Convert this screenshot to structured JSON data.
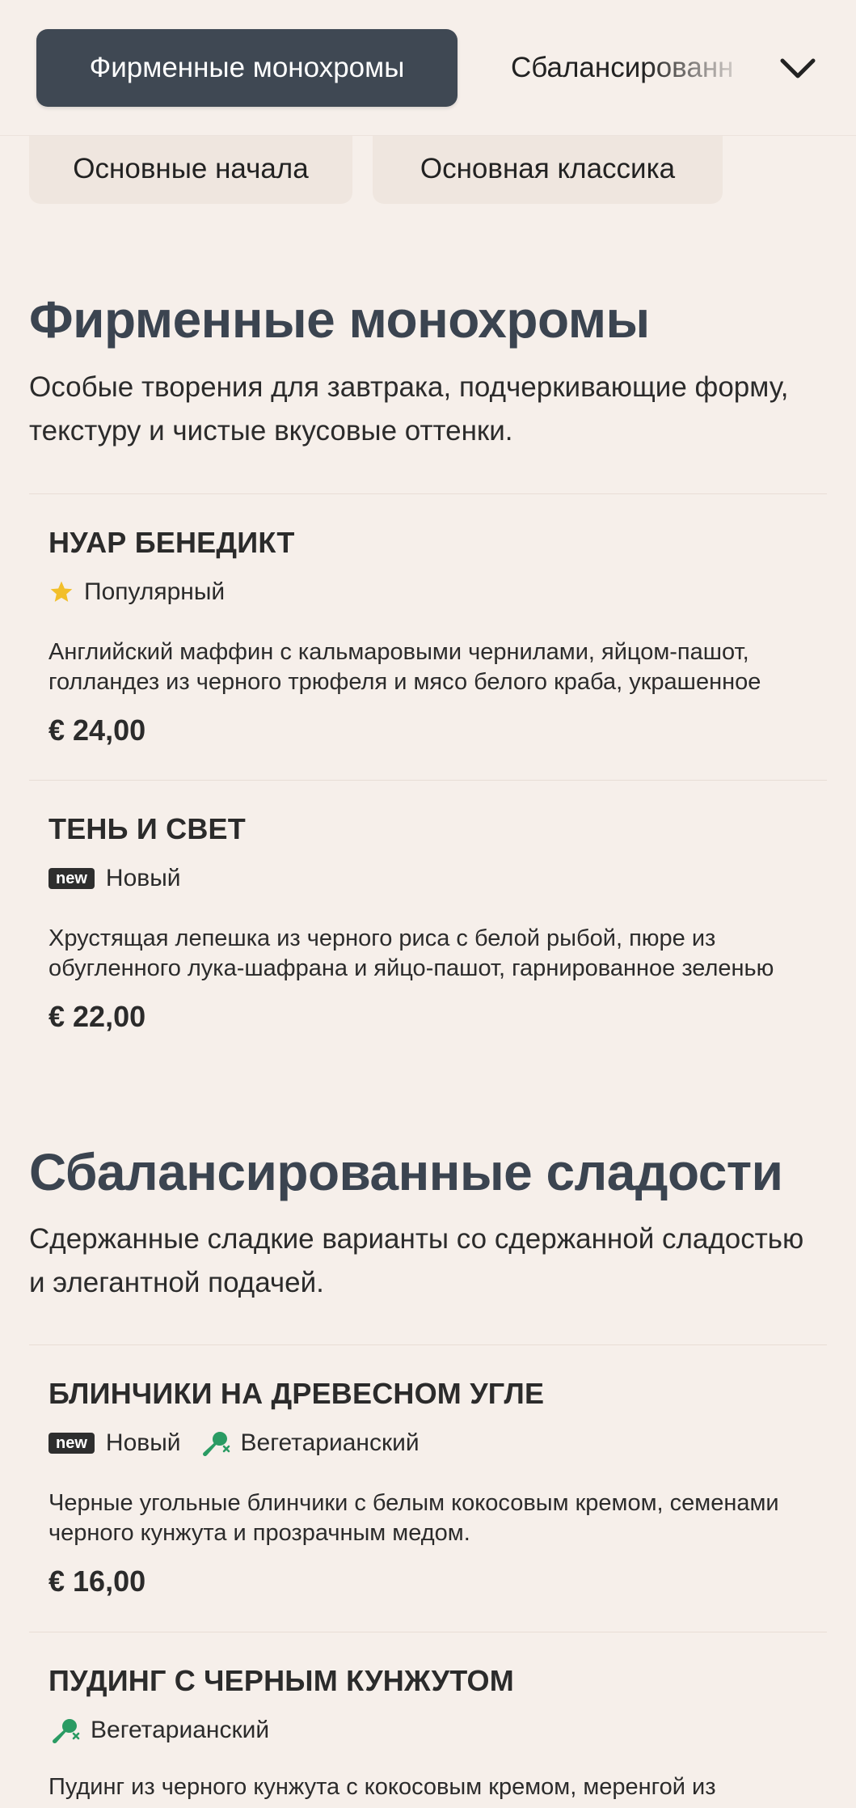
{
  "tabs": {
    "active": "Фирменные монохромы",
    "next": "Сбалансированн",
    "more_icon": "chevron-down-icon"
  },
  "chips": [
    "Основные начала",
    "Основная классика"
  ],
  "sections": [
    {
      "title": "Фирменные монохромы",
      "description": "Особые творения для завтрака, подчеркивающие форму, текстуру и чистые вкусовые оттенки.",
      "items": [
        {
          "name": "НУАР БЕНЕДИКТ",
          "tags": [
            {
              "type": "star",
              "label": "Популярный"
            }
          ],
          "description": "Английский маффин с кальмаровыми чернилами, яйцом-пашот, голландез из черного трюфеля и мясо белого краба, украшенное",
          "price": "€ 24,00"
        },
        {
          "name": "ТЕНЬ И СВЕТ",
          "tags": [
            {
              "type": "new",
              "badge": "new",
              "label": "Новый"
            }
          ],
          "description": "Хрустящая лепешка из черного риса с белой рыбой, пюре из обугленного лука-шафрана и яйцо-пашот, гарнированное зеленью",
          "price": "€ 22,00"
        }
      ]
    },
    {
      "title": "Сбалансированные сладости",
      "description": "Сдержанные сладкие варианты со сдержанной сладостью и элегантной подачей.",
      "items": [
        {
          "name": "БЛИНЧИКИ НА ДРЕВЕСНОМ УГЛЕ",
          "tags": [
            {
              "type": "new",
              "badge": "new",
              "label": "Новый"
            },
            {
              "type": "veg",
              "label": "Вегетарианский"
            }
          ],
          "description": "Черные угольные блинчики с белым кокосовым кремом, семенами черного кунжута и прозрачным медом.",
          "price": "€ 16,00"
        },
        {
          "name": "ПУДИНГ С ЧЕРНЫМ КУНЖУТОМ",
          "tags": [
            {
              "type": "veg",
              "label": "Вегетарианский"
            }
          ],
          "description": "Пудинг из черного кунжута с кокосовым кремом, меренгой из",
          "price": ""
        }
      ]
    }
  ],
  "colors": {
    "background": "#f6efea",
    "active_tab": "#3f4853",
    "title": "#3b4450",
    "star": "#f2bf2a",
    "veg": "#2a9b63"
  }
}
